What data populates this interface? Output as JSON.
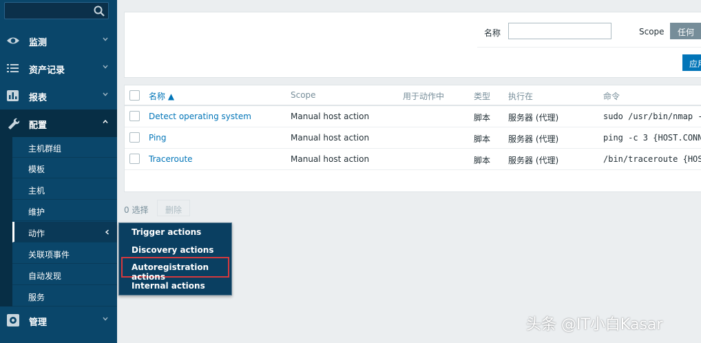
{
  "sidebar": {
    "menu": [
      {
        "label": "监测",
        "icon": "eye-icon"
      },
      {
        "label": "资产记录",
        "icon": "list-icon"
      },
      {
        "label": "报表",
        "icon": "bar-chart-icon"
      },
      {
        "label": "配置",
        "icon": "wrench-icon"
      },
      {
        "label": "管理",
        "icon": "gear-icon"
      }
    ],
    "submenu": [
      "主机群组",
      "模板",
      "主机",
      "维护",
      "动作",
      "关联项事件",
      "自动发现",
      "服务"
    ]
  },
  "flyout": {
    "items": [
      "Trigger actions",
      "Discovery actions",
      "Autoregistration actions",
      "Internal actions"
    ]
  },
  "filter": {
    "name_label": "名称",
    "name_value": "",
    "scope_label": "Scope",
    "scope_value": "任何",
    "apply_label": "应用"
  },
  "table": {
    "headers": [
      "名称 ▲",
      "Scope",
      "用于动作中",
      "类型",
      "执行在",
      "命令"
    ],
    "rows": [
      {
        "name": "Detect operating system",
        "scope": "Manual host action",
        "type": "脚本",
        "exec": "服务器 (代理)",
        "command": "sudo /usr/bin/nmap -"
      },
      {
        "name": "Ping",
        "scope": "Manual host action",
        "type": "脚本",
        "exec": "服务器 (代理)",
        "command": "ping -c 3 {HOST.CONN"
      },
      {
        "name": "Traceroute",
        "scope": "Manual host action",
        "type": "脚本",
        "exec": "服务器 (代理)",
        "command": "/bin/traceroute {HOS"
      }
    ]
  },
  "footer": {
    "selected": "0 选择",
    "delete_label": "删除"
  },
  "watermark": "头条 @IT小白Kasar",
  "colors": {
    "sidebar": "#0a466a",
    "link": "#0275b8",
    "highlight": "#d6393d"
  }
}
